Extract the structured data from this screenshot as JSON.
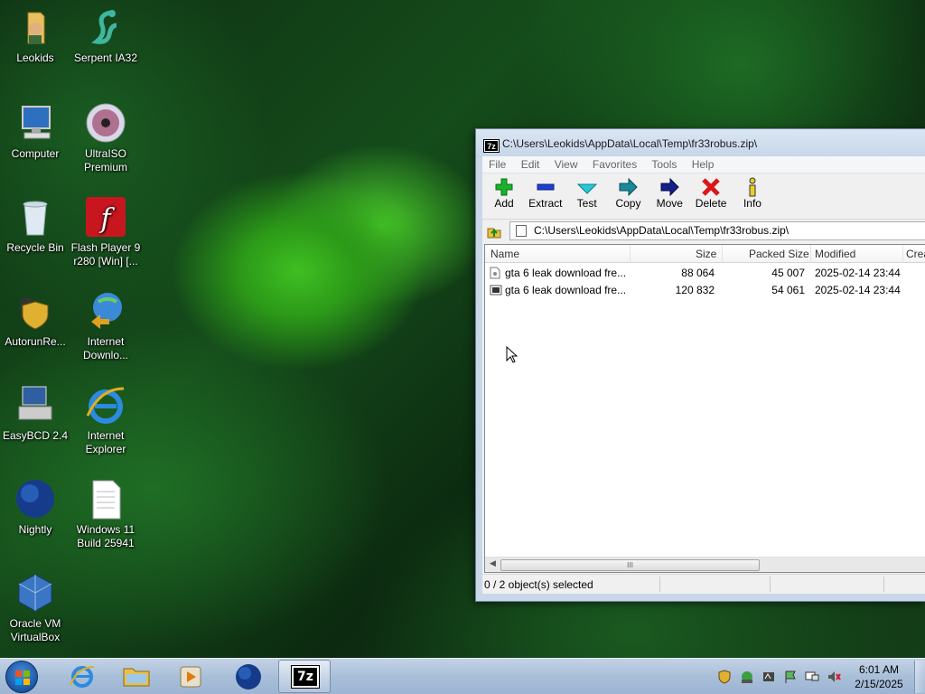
{
  "desktop": {
    "icons": [
      {
        "label": "Leokids"
      },
      {
        "label": "Serpent IA32"
      },
      {
        "label": "Computer"
      },
      {
        "label": "UltraISO Premium"
      },
      {
        "label": "Recycle Bin"
      },
      {
        "label": "Flash Player 9 r280 [Win] [..."
      },
      {
        "label": "AutorunRe..."
      },
      {
        "label": "Internet Downlo..."
      },
      {
        "label": "EasyBCD 2.4"
      },
      {
        "label": "Internet Explorer"
      },
      {
        "label": "Nightly"
      },
      {
        "label": "Windows 11 Build 25941"
      },
      {
        "label": "Oracle VM VirtualBox"
      }
    ]
  },
  "window": {
    "title": "C:\\Users\\Leokids\\AppData\\Local\\Temp\\fr33robus.zip\\",
    "app_icon_text": "7z",
    "menu": [
      "File",
      "Edit",
      "View",
      "Favorites",
      "Tools",
      "Help"
    ],
    "toolbar": [
      "Add",
      "Extract",
      "Test",
      "Copy",
      "Move",
      "Delete",
      "Info"
    ],
    "address": "C:\\Users\\Leokids\\AppData\\Local\\Temp\\fr33robus.zip\\",
    "columns": [
      "Name",
      "Size",
      "Packed Size",
      "Modified",
      "Crea"
    ],
    "rows": [
      {
        "name": "gta 6 leak download fre...",
        "size": "88 064",
        "packed": "45 007",
        "modified": "2025-02-14 23:44"
      },
      {
        "name": "gta 6 leak download fre...",
        "size": "120 832",
        "packed": "54 061",
        "modified": "2025-02-14 23:44"
      }
    ],
    "scroll_thumb": "III",
    "status": "0 / 2 object(s) selected"
  },
  "taskbar": {
    "active_label": "7z",
    "time": "6:01 AM",
    "date": "2/15/2025"
  },
  "colors": {
    "accent": "#1a56a5",
    "window_frame": "#c9d7e8"
  }
}
